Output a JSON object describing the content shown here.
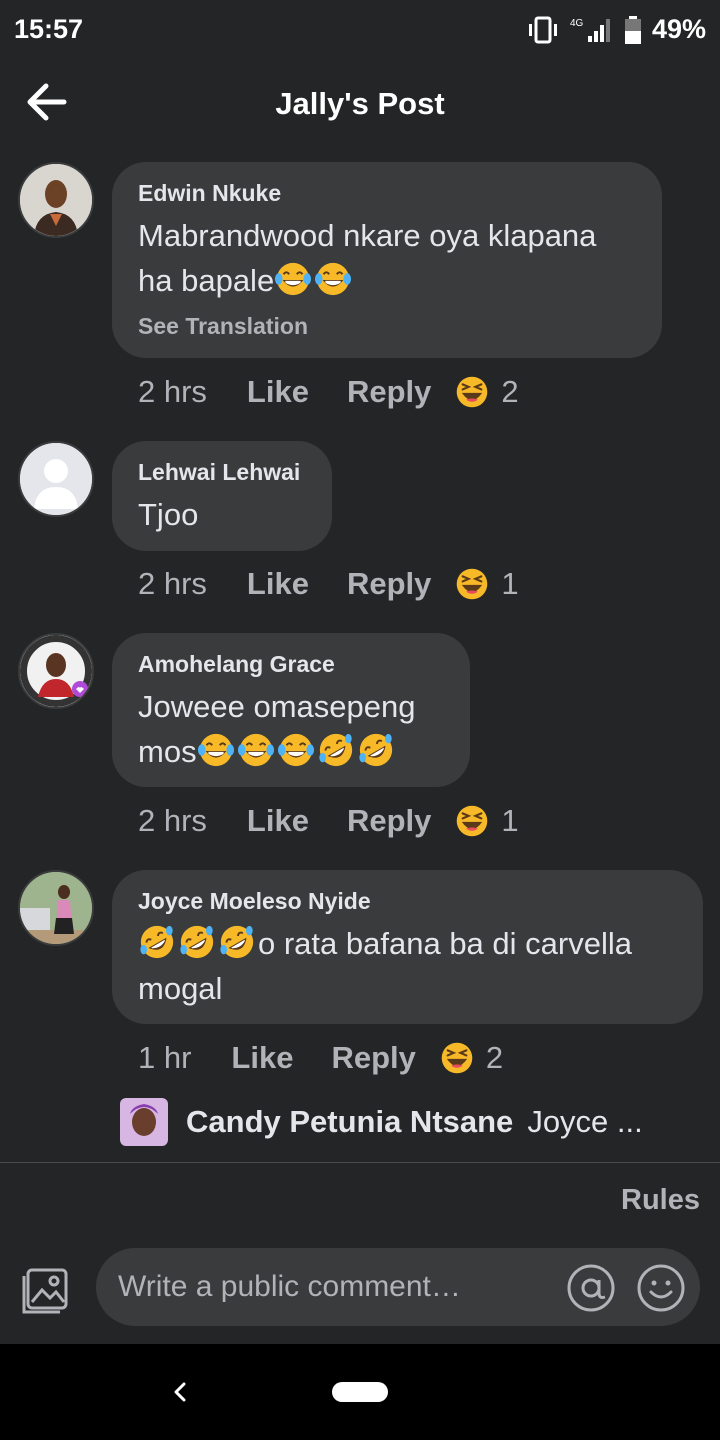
{
  "status_bar": {
    "time": "15:57",
    "network": "4G",
    "battery": "49%"
  },
  "header": {
    "title": "Jally's Post"
  },
  "comments": [
    {
      "author": "Edwin Nkuke",
      "text": "Mabrandwood nkare oya klapana ha bapale",
      "emojis": [
        "tears-of-joy-emoji",
        "tears-of-joy-emoji"
      ],
      "see_translation": "See Translation",
      "time": "2 hrs",
      "like": "Like",
      "reply": "Reply",
      "reactions": "2"
    },
    {
      "author": "Lehwai Lehwai",
      "text": "Tjoo",
      "time": "2 hrs",
      "like": "Like",
      "reply": "Reply",
      "reactions": "1"
    },
    {
      "author": "Amohelang Grace",
      "text_line1": "Joweee omasepeng",
      "text_line2": "mos",
      "emojis": [
        "tears-of-joy-emoji",
        "tears-of-joy-emoji",
        "tears-of-joy-emoji",
        "rofl-emoji",
        "rofl-emoji"
      ],
      "time": "2 hrs",
      "like": "Like",
      "reply": "Reply",
      "reactions": "1"
    },
    {
      "author": "Joyce Moeleso Nyide",
      "text_line1": "o rata bafana ba di carvella",
      "text_line2": "mogal",
      "emojis": [
        "rofl-emoji",
        "rofl-emoji",
        "rofl-emoji"
      ],
      "time": "1 hr",
      "like": "Like",
      "reply": "Reply",
      "reactions": "2"
    }
  ],
  "reply_preview": {
    "name": "Candy Petunia Ntsane",
    "text": "Joyce ..."
  },
  "rules": "Rules",
  "composer": {
    "placeholder": "Write a public comment…"
  },
  "colors": {
    "background": "#242526",
    "bubble": "#3a3b3c",
    "secondary_text": "#b0b3b8",
    "emoji_yellow": "#f7b928"
  }
}
